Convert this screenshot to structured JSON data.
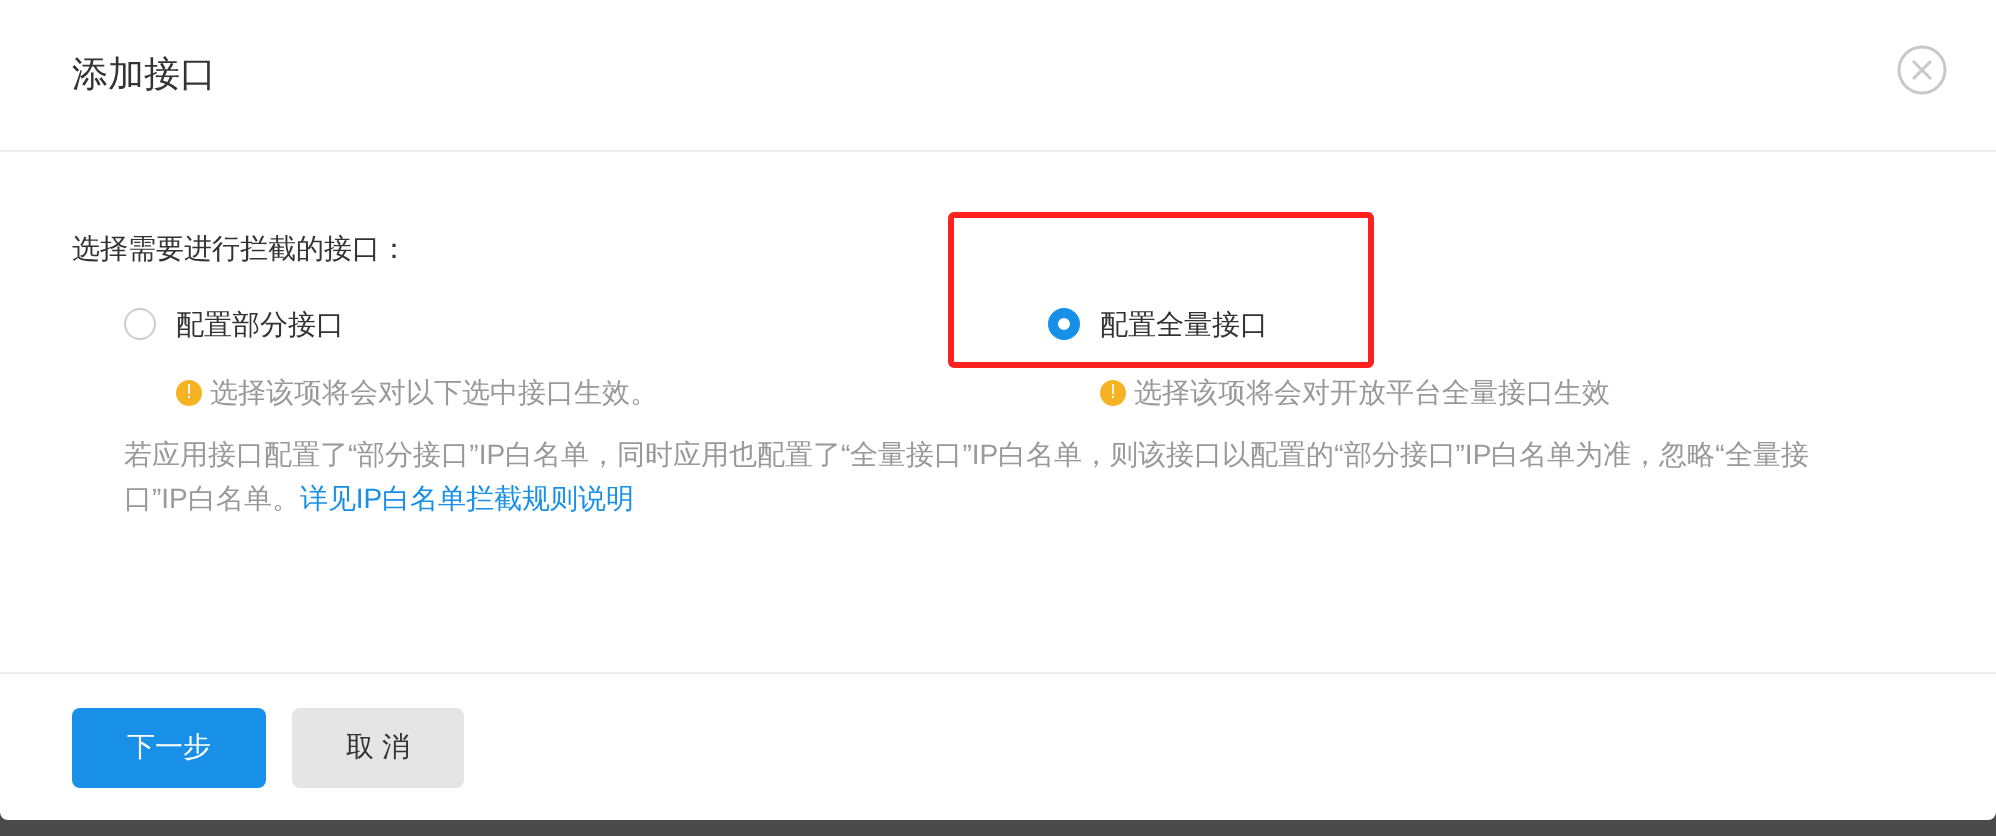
{
  "dialog": {
    "title": "添加接口"
  },
  "prompt": "选择需要进行拦截的接口：",
  "options": [
    {
      "label": "配置部分接口",
      "selected": false,
      "hint": "选择该项将会对以下选中接口生效。",
      "hint_icon": "!"
    },
    {
      "label": "配置全量接口",
      "selected": true,
      "hint": "选择该项将会对开放平台全量接口生效",
      "hint_icon": "!"
    }
  ],
  "note": "若应用接口配置了“部分接口”IP白名单，同时应用也配置了“全量接口”IP白名单，则该接口以配置的“部分接口”IP白名单为准，忽略“全量接口”IP白名单。",
  "note_link": "详见IP白名单拦截规则说明",
  "buttons": [
    {
      "label": "下一步",
      "kind": "primary"
    },
    {
      "label": "取 消",
      "kind": "secondary"
    }
  ]
}
